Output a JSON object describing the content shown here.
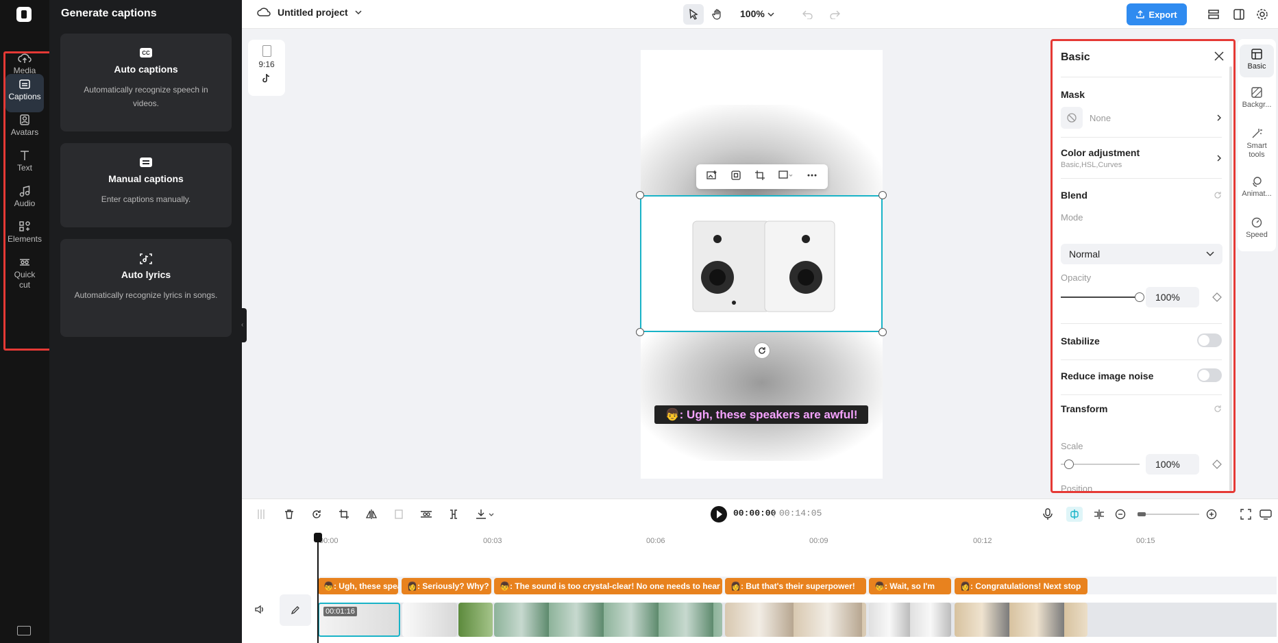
{
  "rail": {
    "items": [
      {
        "label": "Media",
        "icon": "cloud-upload-icon"
      },
      {
        "label": "Captions",
        "icon": "captions-icon"
      },
      {
        "label": "Avatars",
        "icon": "avatar-icon"
      },
      {
        "label": "Text",
        "icon": "text-icon"
      },
      {
        "label": "Audio",
        "icon": "music-note-icon"
      },
      {
        "label": "Elements",
        "icon": "elements-icon"
      },
      {
        "label": "Quick cut",
        "icon": "quick-cut-icon"
      }
    ],
    "active": "Captions"
  },
  "panel": {
    "title": "Generate captions",
    "cards": [
      {
        "title": "Auto captions",
        "desc": "Automatically recognize speech in videos."
      },
      {
        "title": "Manual captions",
        "desc": "Enter captions manually."
      },
      {
        "title": "Auto lyrics",
        "desc": "Automatically recognize lyrics in songs."
      }
    ]
  },
  "topbar": {
    "project": "Untitled project",
    "zoom": "100%",
    "export": "Export"
  },
  "canvas": {
    "ratio": "9:16",
    "subtitle": "👦: Ugh, these speakers are awful!"
  },
  "props": {
    "title": "Basic",
    "mask": {
      "label": "Mask",
      "value": "None"
    },
    "color": {
      "label": "Color adjustment",
      "sub": "Basic,HSL,Curves"
    },
    "blend": {
      "label": "Blend",
      "mode_label": "Mode",
      "mode": "Normal",
      "opacity_label": "Opacity",
      "opacity": "100%",
      "opacity_level": 1.0
    },
    "stabilize": "Stabilize",
    "noise": "Reduce image noise",
    "transform": {
      "label": "Transform",
      "scale_label": "Scale",
      "scale": "100%",
      "scale_level": 0.1,
      "position_label": "Position"
    }
  },
  "rtabs": [
    {
      "label": "Basic",
      "icon": "basic-icon"
    },
    {
      "label": "Backgr...",
      "icon": "background-icon"
    },
    {
      "label": "Smart tools",
      "icon": "magic-wand-icon"
    },
    {
      "label": "Animat...",
      "icon": "animation-icon"
    },
    {
      "label": "Speed",
      "icon": "speed-icon"
    }
  ],
  "timeline": {
    "current": "00:00:00",
    "total": "00:14:05",
    "ruler": [
      "00:00",
      "00:03",
      "00:06",
      "00:09",
      "00:12",
      "00:15"
    ],
    "captions": [
      "👦: Ugh, these speakers are awful!",
      "👩: Seriously? Why?",
      "👦: The sound is too crystal-clear! No one needs to hear that",
      "👩: But that's their superpower!",
      "👦: Wait, so I'm",
      "👩: Congratulations! Next stop"
    ],
    "clip_time": "00:01:16"
  },
  "colors": {
    "accent": "#2f8bf0",
    "caption": "#e8821e",
    "selection": "#18b3c7",
    "highlight": "#e53935"
  }
}
